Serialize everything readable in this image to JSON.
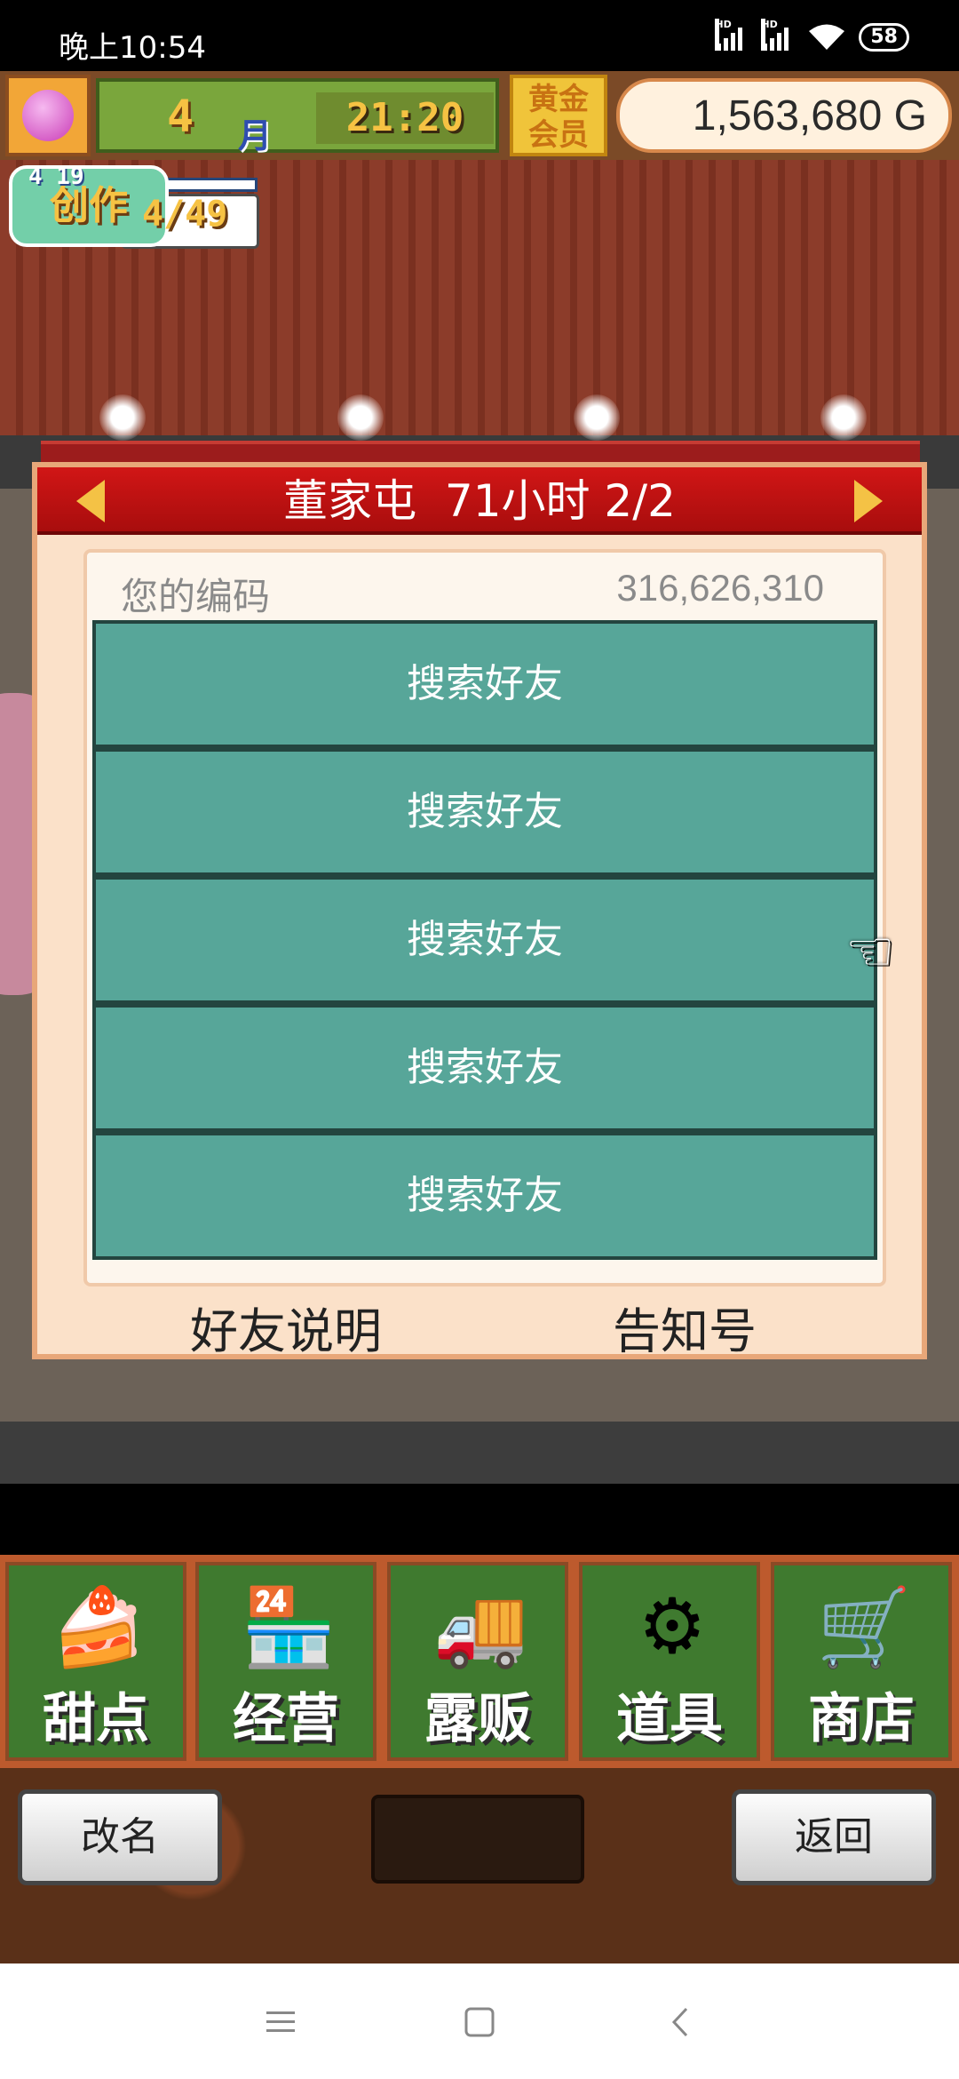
{
  "status_bar": {
    "time": "晚上10:54",
    "signal_labels": [
      "HD",
      "HD"
    ],
    "battery": "58"
  },
  "hud": {
    "month": "4",
    "month_unit": "月",
    "clock": "21:20",
    "gold_member": "黄金\n会员",
    "money": "1,563,680 G"
  },
  "creation": {
    "date": "4 19",
    "label": "创作",
    "count": "4/49"
  },
  "modal": {
    "title": "董家屯  71小时 2/2",
    "code_label": "您的编码",
    "code_value": "316,626,310",
    "friend_buttons": [
      "搜索好友",
      "搜索好友",
      "搜索好友",
      "搜索好友",
      "搜索好友"
    ],
    "footer_left": "好友说明",
    "footer_right": "告知号"
  },
  "menu": {
    "items": [
      {
        "label": "甜点",
        "icon": "cake-icon"
      },
      {
        "label": "经营",
        "icon": "shop-icon"
      },
      {
        "label": "露贩",
        "icon": "food-truck-icon"
      },
      {
        "label": "道具",
        "icon": "gear-bag-icon"
      },
      {
        "label": "商店",
        "icon": "cart-icon"
      }
    ]
  },
  "actions": {
    "rename": "改名",
    "back": "返回"
  },
  "colors": {
    "teal_button": "#57a699",
    "modal_header": "#d11616",
    "menu_green": "#3f7a2f"
  }
}
